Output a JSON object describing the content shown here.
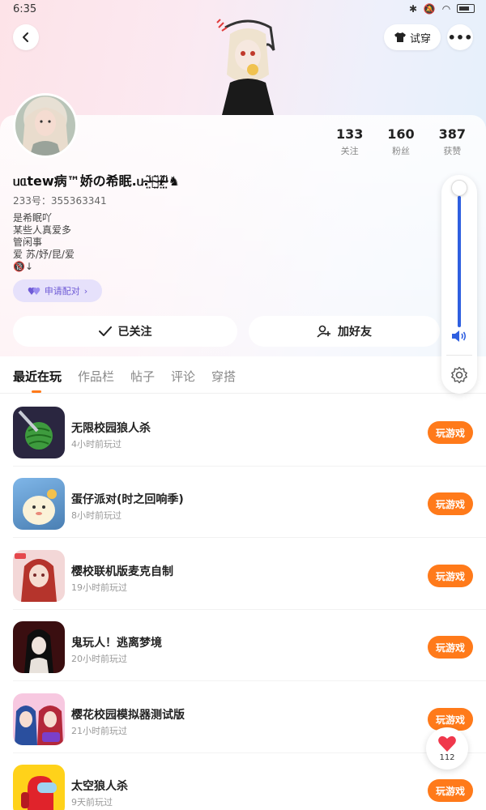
{
  "status_bar": {
    "time": "6:35"
  },
  "header": {
    "tryon_label": "试穿"
  },
  "profile": {
    "nickname": "ᥙᥲtew病™娇の希眠.ᥙ.ᵎ̴̤͂ᩦ̴̤͂ℓ̴̤͂ᵎ̴̤͂♞",
    "uid": "233号：355363341",
    "bio": [
      "是希眠吖",
      "某些人真爱多",
      "管闲事",
      "爱 苏/妤/昆/爱",
      "🔞↓"
    ],
    "pair_label": "申请配对",
    "stats": [
      {
        "value": "133",
        "label": "关注"
      },
      {
        "value": "160",
        "label": "粉丝"
      },
      {
        "value": "387",
        "label": "获赞"
      }
    ],
    "follow_label": "已关注",
    "add_friend_label": "加好友"
  },
  "tabs": [
    "最近在玩",
    "作品栏",
    "帖子",
    "评论",
    "穿搭"
  ],
  "play_label": "玩游戏",
  "games": [
    {
      "name": "无限校园狼人杀",
      "time": "4小时前玩过",
      "icon": "watermelon-game-icon"
    },
    {
      "name": "蛋仔派对(时之回响季)",
      "time": "8小时前玩过",
      "icon": "eggy-party-icon"
    },
    {
      "name": "樱校联机版麦克自制",
      "time": "19小时前玩过",
      "icon": "sakura-school-icon"
    },
    {
      "name": "鬼玩人！逃离梦境",
      "time": "20小时前玩过",
      "icon": "ghost-game-icon"
    },
    {
      "name": "樱花校园模拟器测试版",
      "time": "21小时前玩过",
      "icon": "sakura-sim-icon"
    },
    {
      "name": "太空狼人杀",
      "time": "9天前玩过",
      "icon": "among-us-icon"
    }
  ],
  "volume": {
    "level": 0.92
  },
  "like_count": "112",
  "colors": {
    "accent": "#ff7a1a",
    "volume": "#2f5fe0",
    "pair": "#6f5bd6"
  }
}
